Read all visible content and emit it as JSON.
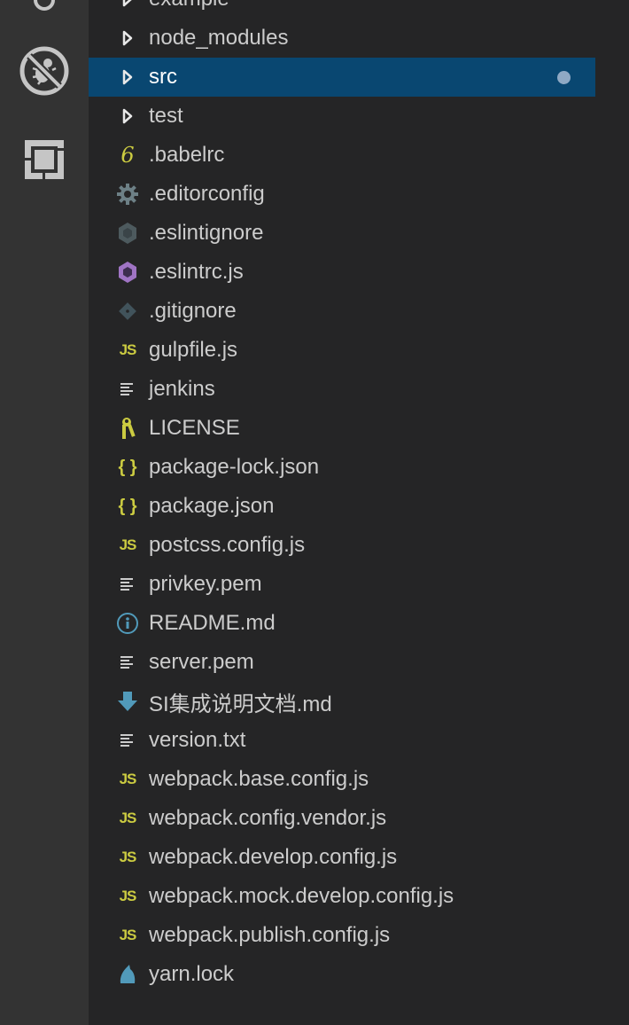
{
  "activity_bar": {
    "items": [
      {
        "icon": "debug-disabled-icon"
      },
      {
        "icon": "extensions-icon"
      }
    ]
  },
  "explorer": {
    "selected_color": "#094771",
    "items": [
      {
        "label": "example",
        "kind": "folder",
        "icon": "chevron-right-icon"
      },
      {
        "label": "node_modules",
        "kind": "folder",
        "icon": "chevron-right-icon"
      },
      {
        "label": "src",
        "kind": "folder",
        "icon": "chevron-right-icon",
        "selected": true,
        "modified_dot": true
      },
      {
        "label": "test",
        "kind": "folder",
        "icon": "chevron-right-icon"
      },
      {
        "label": ".babelrc",
        "kind": "file",
        "icon": "babel-icon",
        "color": "#cbcb41"
      },
      {
        "label": ".editorconfig",
        "kind": "file",
        "icon": "gear-icon",
        "color": "#6d8086"
      },
      {
        "label": ".eslintignore",
        "kind": "file",
        "icon": "eslint-ignore-icon",
        "color": "#4d5a5e"
      },
      {
        "label": ".eslintrc.js",
        "kind": "file",
        "icon": "eslint-icon",
        "color": "#a074c4"
      },
      {
        "label": ".gitignore",
        "kind": "file",
        "icon": "git-icon",
        "color": "#41535b"
      },
      {
        "label": "gulpfile.js",
        "kind": "file",
        "icon": "js-icon",
        "color": "#cbcb41"
      },
      {
        "label": "jenkins",
        "kind": "file",
        "icon": "text-file-icon",
        "color": "#cccccc"
      },
      {
        "label": "LICENSE",
        "kind": "file",
        "icon": "license-key-icon",
        "color": "#cbcb41"
      },
      {
        "label": "package-lock.json",
        "kind": "file",
        "icon": "json-icon",
        "color": "#cbcb41"
      },
      {
        "label": "package.json",
        "kind": "file",
        "icon": "json-icon",
        "color": "#cbcb41"
      },
      {
        "label": "postcss.config.js",
        "kind": "file",
        "icon": "js-icon",
        "color": "#cbcb41"
      },
      {
        "label": "privkey.pem",
        "kind": "file",
        "icon": "text-file-icon",
        "color": "#cccccc"
      },
      {
        "label": "README.md",
        "kind": "file",
        "icon": "info-icon",
        "color": "#519aba"
      },
      {
        "label": "server.pem",
        "kind": "file",
        "icon": "text-file-icon",
        "color": "#cccccc"
      },
      {
        "label": "SI集成说明文档.md",
        "kind": "file",
        "icon": "markdown-icon",
        "color": "#519aba"
      },
      {
        "label": "version.txt",
        "kind": "file",
        "icon": "text-file-icon",
        "color": "#cccccc"
      },
      {
        "label": "webpack.base.config.js",
        "kind": "file",
        "icon": "js-icon",
        "color": "#cbcb41"
      },
      {
        "label": "webpack.config.vendor.js",
        "kind": "file",
        "icon": "js-icon",
        "color": "#cbcb41"
      },
      {
        "label": "webpack.develop.config.js",
        "kind": "file",
        "icon": "js-icon",
        "color": "#cbcb41"
      },
      {
        "label": "webpack.mock.develop.config.js",
        "kind": "file",
        "icon": "js-icon",
        "color": "#cbcb41"
      },
      {
        "label": "webpack.publish.config.js",
        "kind": "file",
        "icon": "js-icon",
        "color": "#cbcb41"
      },
      {
        "label": "yarn.lock",
        "kind": "file",
        "icon": "yarn-icon",
        "color": "#519aba"
      }
    ]
  }
}
